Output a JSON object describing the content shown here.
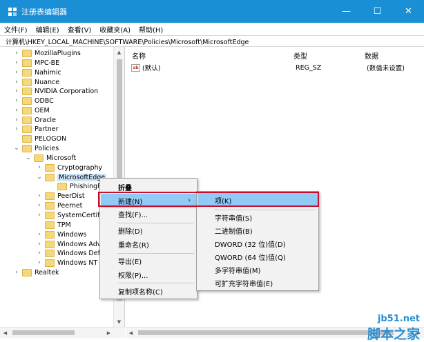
{
  "window": {
    "title": "注册表编辑器",
    "minimize_glyph": "—",
    "maximize_glyph": "☐",
    "close_glyph": "✕"
  },
  "menu": [
    "文件(F)",
    "编辑(E)",
    "查看(V)",
    "收藏夹(A)",
    "帮助(H)"
  ],
  "address": "计算机\\HKEY_LOCAL_MACHINE\\SOFTWARE\\Policies\\Microsoft\\MicrosoftEdge",
  "tree": [
    {
      "label": "MozillaPlugins",
      "expander": "›"
    },
    {
      "label": "MPC-BE",
      "expander": "›"
    },
    {
      "label": "Nahimic",
      "expander": "›"
    },
    {
      "label": "Nuance",
      "expander": "›"
    },
    {
      "label": "NVIDIA Corporation",
      "expander": "›"
    },
    {
      "label": "ODBC",
      "expander": "›"
    },
    {
      "label": "OEM",
      "expander": "›"
    },
    {
      "label": "Oracle",
      "expander": "›"
    },
    {
      "label": "Partner",
      "expander": "›"
    },
    {
      "label": "PELOGON",
      "expander": ""
    },
    {
      "label": "Policies",
      "expander": "⌄"
    },
    {
      "label": "Microsoft",
      "expander": "⌄"
    },
    {
      "label": "Cryptography",
      "expander": "›"
    },
    {
      "label": "MicrosoftEdge",
      "expander": "⌄"
    },
    {
      "label": "PhishingFi",
      "expander": ""
    },
    {
      "label": "PeerDist",
      "expander": "›"
    },
    {
      "label": "Peernet",
      "expander": "›"
    },
    {
      "label": "SystemCertific",
      "expander": "›"
    },
    {
      "label": "TPM",
      "expander": ""
    },
    {
      "label": "Windows",
      "expander": "›"
    },
    {
      "label": "Windows Adv",
      "expander": "›"
    },
    {
      "label": "Windows Defe",
      "expander": "›"
    },
    {
      "label": "Windows NT",
      "expander": "›"
    },
    {
      "label": "Realtek",
      "expander": "›"
    }
  ],
  "list": {
    "columns": [
      "名称",
      "类型",
      "数据"
    ],
    "rows": [
      {
        "icon": "ab",
        "name": "(默认)",
        "type": "REG_SZ",
        "data": "(数值未设置)"
      }
    ]
  },
  "context_menu": {
    "items": [
      "折叠",
      "新建(N)",
      "查找(F)...",
      "删除(D)",
      "重命名(R)",
      "导出(E)",
      "权限(P)...",
      "复制项名称(C)"
    ],
    "submenu_arrow": "›"
  },
  "submenu": {
    "items": [
      "项(K)",
      "字符串值(S)",
      "二进制值(B)",
      "DWORD (32 位)值(D)",
      "QWORD (64 位)值(Q)",
      "多字符串值(M)",
      "可扩充字符串值(E)"
    ]
  },
  "watermark": {
    "url": "jb51.net",
    "text": "脚本之家"
  },
  "colors": {
    "titlebar": "#1a8fd6",
    "highlight": "#91c9f7",
    "selection": "#cce4f7",
    "annotation_box": "#c8102e",
    "folder": "#f5d87a"
  }
}
